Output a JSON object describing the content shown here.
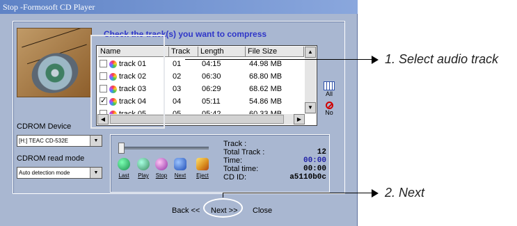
{
  "window": {
    "title": "Stop -Formosoft CD Player"
  },
  "header": {
    "text": "Check the track(s) you want to compress"
  },
  "table": {
    "columns": [
      "Name",
      "Track",
      "Length",
      "File Size"
    ],
    "rows": [
      {
        "name": "track 01",
        "track": "01",
        "length": "04:15",
        "size": "44.98 MB",
        "checked": ""
      },
      {
        "name": "track 02",
        "track": "02",
        "length": "06:30",
        "size": "68.80 MB",
        "checked": ""
      },
      {
        "name": "track 03",
        "track": "03",
        "length": "06:29",
        "size": "68.62 MB",
        "checked": ""
      },
      {
        "name": "track 04",
        "track": "04",
        "length": "05:11",
        "size": "54.86 MB",
        "checked": "✓"
      },
      {
        "name": "track 05",
        "track": "05",
        "length": "05:42",
        "size": "60.33 MB",
        "checked": ""
      }
    ]
  },
  "side_buttons": {
    "all_label": "All",
    "no_label": "No"
  },
  "device": {
    "label": "CDROM Device",
    "value": "[H:] TEAC    CD-532E",
    "read_mode_label": "CDROM read mode",
    "read_mode_value": "Auto detection mode"
  },
  "player": {
    "buttons": [
      "Last",
      "Play",
      "Stop",
      "Next",
      "Eject"
    ],
    "track_label": "Track :",
    "track_value": "",
    "total_track_label": "Total Track :",
    "total_track_value": "12",
    "time_label": "Time:",
    "time_value": "00:00",
    "total_time_label": "Total time:",
    "total_time_value": "00:00",
    "cdid_label": "CD ID:",
    "cdid_value": "a5110b0c"
  },
  "nav": {
    "back_label": "Back <<",
    "next_label": "Next >>",
    "close_label": "Close"
  },
  "annotations": {
    "step1": "1. Select audio track",
    "step2": "2. Next"
  },
  "colors": {
    "title_bar": "#5f83c6",
    "window_bg": "#a9b7d1",
    "header_text": "#2f36c8",
    "time_value": "#1f1fa7"
  }
}
